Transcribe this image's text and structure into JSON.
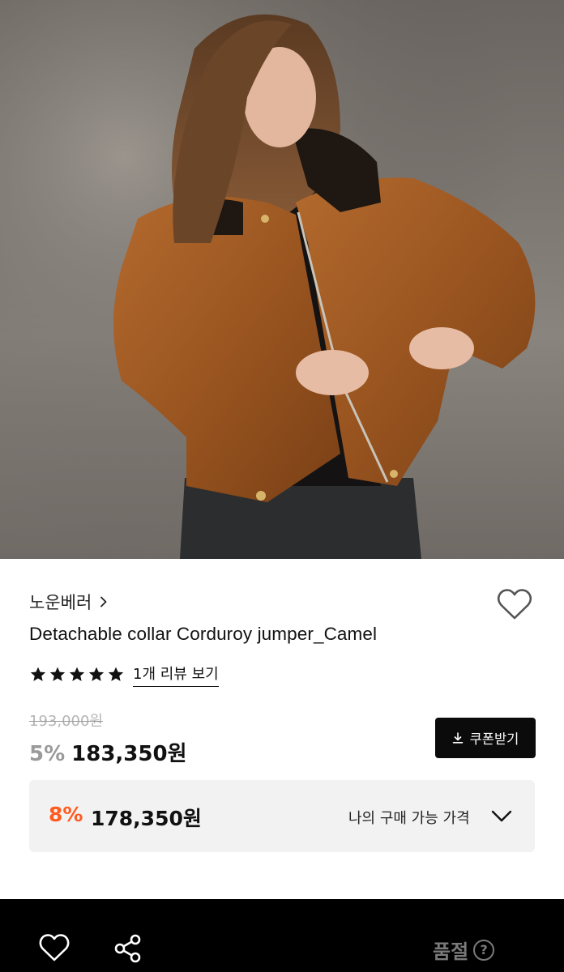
{
  "brand": {
    "name": "노운베러"
  },
  "product": {
    "title": "Detachable collar Corduroy jumper_Camel",
    "rating_stars": 5,
    "review_link": "1개 리뷰 보기",
    "original_price": "193,000원",
    "discount_rate": "5%",
    "sale_price": "183,350원",
    "coupon_label": "쿠폰받기"
  },
  "my_price": {
    "discount_rate": "8%",
    "price": "178,350원",
    "label": "나의 구매 가능 가격"
  },
  "bottom_bar": {
    "status_label": "품절",
    "help_glyph": "?"
  },
  "icons": {
    "brand_chevron": "chevron-right-icon",
    "wishlist": "heart-outline-icon",
    "star": "star-icon",
    "coupon": "download-icon",
    "expand": "chevron-down-icon",
    "share": "share-icon",
    "help": "question-circle-icon"
  },
  "colors": {
    "accent": "#ff5a1f",
    "bottom_bar": "#000000",
    "coupon_button": "#0b0b0b",
    "muted": "#9a9a9a"
  }
}
